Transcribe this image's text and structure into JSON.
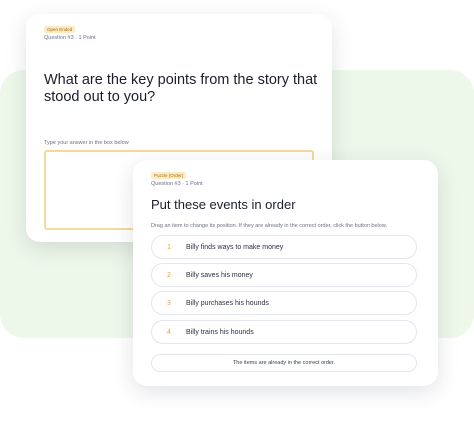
{
  "colors": {
    "background_panel": "#edf7ea",
    "badge_bg": "#fdebc6",
    "badge_text": "#a36a12",
    "answer_border": "#f6d89a",
    "item_number": "#e4a23a"
  },
  "question_card_1": {
    "badge": "Open Ended",
    "meta": "Question #3 · 1 Point",
    "title": "What are the key points from the story that stood out to you?",
    "hint": "Type your answer in the box below",
    "answer_value": ""
  },
  "question_card_2": {
    "badge": "Puzzle (Order)",
    "meta": "Question #3 · 1 Point",
    "title": "Put these events in order",
    "instructions": "Drag an item to change its position. If they are already in the correct order, click the button below.",
    "items": [
      {
        "number": "1",
        "label": "Billy finds ways to make money"
      },
      {
        "number": "2",
        "label": "Billy saves his money"
      },
      {
        "number": "3",
        "label": "Billy purchases his hounds"
      },
      {
        "number": "4",
        "label": "Billy trains his hounds"
      }
    ],
    "confirm_button": "The items are already in the correct order."
  }
}
